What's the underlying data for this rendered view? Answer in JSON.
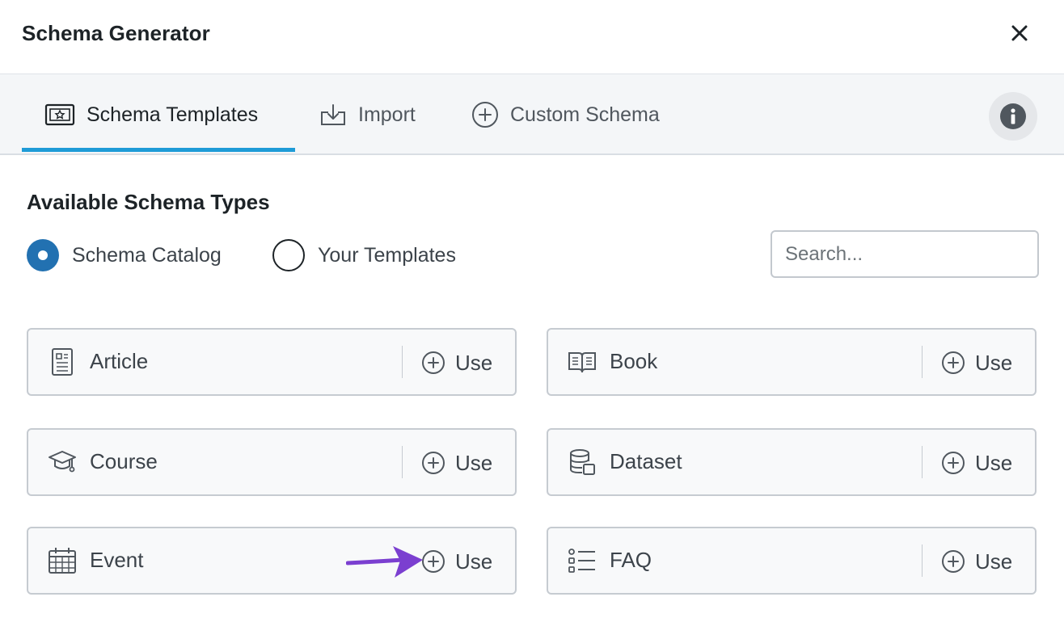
{
  "header": {
    "title": "Schema Generator"
  },
  "tabs": [
    {
      "label": "Schema Templates",
      "icon": "certificate-icon",
      "active": true
    },
    {
      "label": "Import",
      "icon": "download-icon",
      "active": false
    },
    {
      "label": "Custom Schema",
      "icon": "plus-circle-icon",
      "active": false
    }
  ],
  "section": {
    "title": "Available Schema Types"
  },
  "filters": [
    {
      "label": "Schema Catalog",
      "checked": true
    },
    {
      "label": "Your Templates",
      "checked": false
    }
  ],
  "search": {
    "placeholder": "Search...",
    "value": ""
  },
  "schema_types": [
    {
      "name": "Article",
      "icon": "article-icon",
      "action": "Use"
    },
    {
      "name": "Book",
      "icon": "book-icon",
      "action": "Use"
    },
    {
      "name": "Course",
      "icon": "graduation-cap-icon",
      "action": "Use"
    },
    {
      "name": "Dataset",
      "icon": "database-icon",
      "action": "Use"
    },
    {
      "name": "Event",
      "icon": "calendar-icon",
      "action": "Use"
    },
    {
      "name": "FAQ",
      "icon": "list-icon",
      "action": "Use"
    }
  ],
  "colors": {
    "accent": "#1e9bd7",
    "radio_checked": "#2271b1",
    "pointer_arrow": "#7b3fd0"
  }
}
